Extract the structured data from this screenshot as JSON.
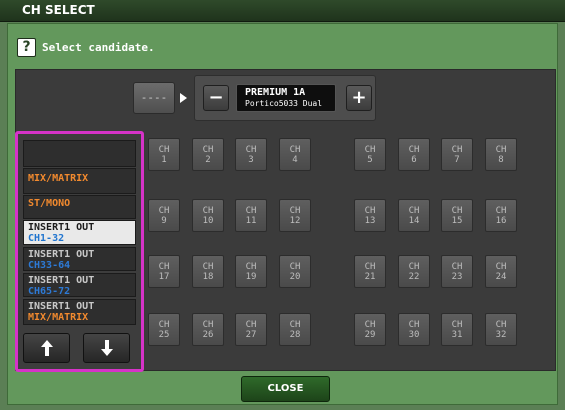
{
  "window": {
    "title": "CH SELECT"
  },
  "prompt": {
    "icon": "question-icon",
    "icon_glyph": "?",
    "text": "Select candidate."
  },
  "header": {
    "dash_label": "----",
    "minus_label": "−",
    "plus_label": "+",
    "device_name": "PREMIUM 1A",
    "device_model": "Portico5033 Dual"
  },
  "list": {
    "items": [
      {
        "line1": "",
        "line2": ""
      },
      {
        "line1": "MIX/MATRIX",
        "line2": ""
      },
      {
        "line1": "ST/MONO",
        "line2": ""
      },
      {
        "line1": "INSERT1 OUT",
        "line2": "CH1-32"
      },
      {
        "line1": "INSERT1 OUT",
        "line2": "CH33-64"
      },
      {
        "line1": "INSERT1 OUT",
        "line2": "CH65-72"
      },
      {
        "line1": "INSERT1 OUT",
        "line2": "MIX/MATRIX"
      }
    ],
    "up_icon": "arrow-up-icon",
    "down_icon": "arrow-down-icon"
  },
  "channels": {
    "prefix": "CH",
    "numbers": [
      "1",
      "2",
      "3",
      "4",
      "5",
      "6",
      "7",
      "8",
      "9",
      "10",
      "11",
      "12",
      "13",
      "14",
      "15",
      "16",
      "17",
      "18",
      "19",
      "20",
      "21",
      "22",
      "23",
      "24",
      "25",
      "26",
      "27",
      "28",
      "29",
      "30",
      "31",
      "32"
    ]
  },
  "footer": {
    "close_label": "CLOSE"
  },
  "colors": {
    "frame_green": "#63985c",
    "selection_magenta": "#d633c8",
    "accent_orange": "#f28a2e",
    "accent_blue": "#1f74cf"
  }
}
